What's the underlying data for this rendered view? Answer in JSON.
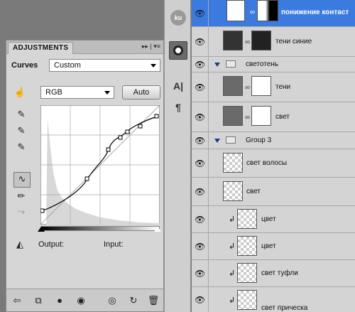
{
  "adjustments": {
    "tab_title": "ADJUSTMENTS",
    "menu_glyphs": "▸▸ | ▾≡",
    "type_label": "Curves",
    "preset_value": "Custom",
    "channel_value": "RGB",
    "auto_label": "Auto",
    "output_label": "Output:",
    "input_label": "Input:"
  },
  "layers": [
    {
      "name": "понижение контаст",
      "type": "adjustment",
      "selected": true
    },
    {
      "name": "тени синие",
      "type": "masked"
    },
    {
      "name": "светотень",
      "type": "group"
    },
    {
      "name": "тени",
      "type": "masked"
    },
    {
      "name": "свет",
      "type": "masked"
    },
    {
      "name": "Group 3",
      "type": "group"
    },
    {
      "name": "свет волосы",
      "type": "layer"
    },
    {
      "name": "свет",
      "type": "layer"
    },
    {
      "name": "цвет",
      "type": "clipped"
    },
    {
      "name": "цвет",
      "type": "clipped"
    },
    {
      "name": "свет туфли",
      "type": "clipped"
    },
    {
      "name": "свет прическа",
      "type": "clipped"
    }
  ],
  "dock": {
    "ku_label": "ku"
  },
  "colors": {
    "selected_row": "#3b7be0",
    "panel": "#d6d6d6"
  }
}
